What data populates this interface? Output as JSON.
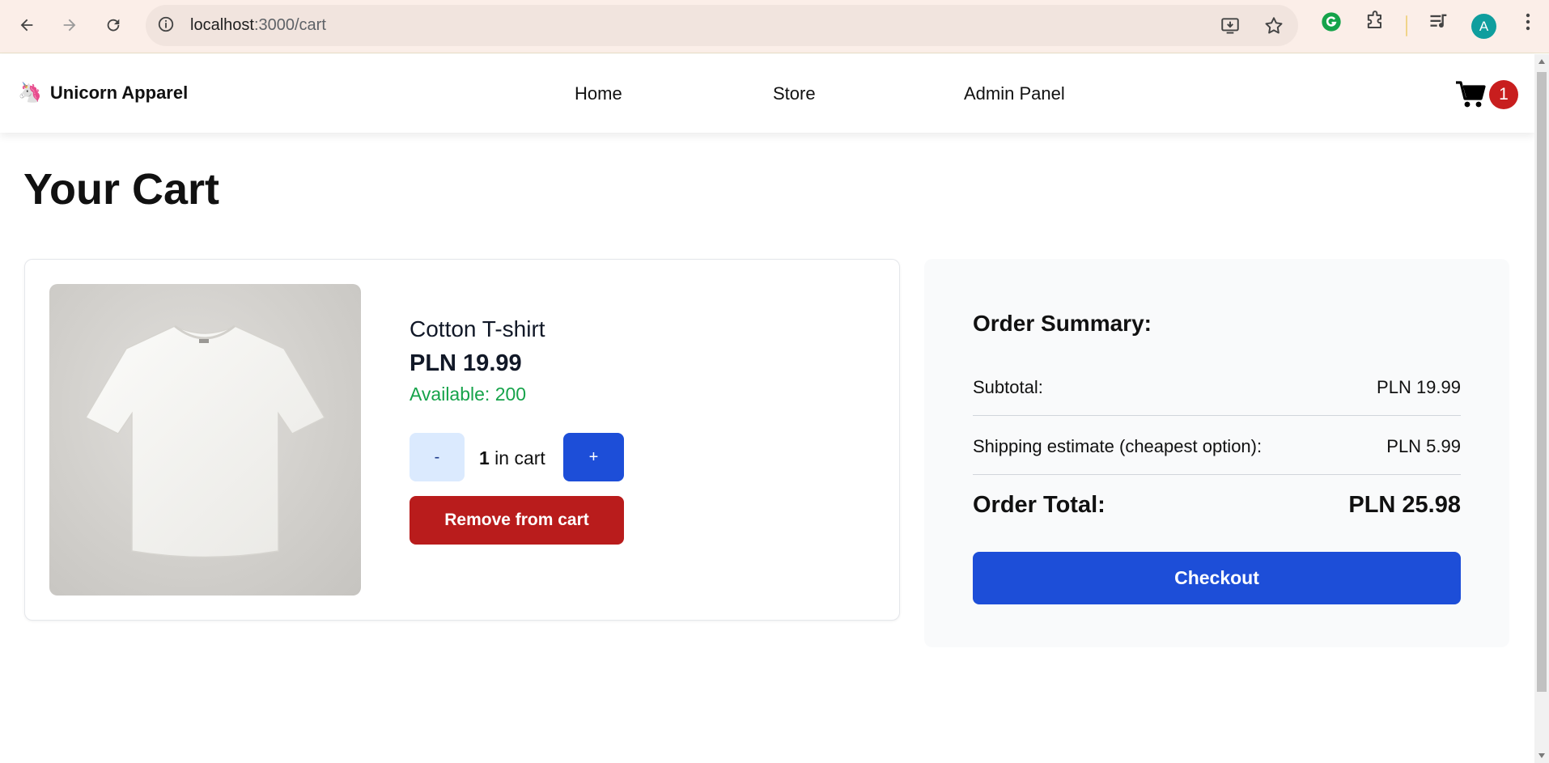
{
  "browser": {
    "url_host": "localhost",
    "url_path": ":3000/cart",
    "profile_initial": "A"
  },
  "header": {
    "brand_logo": "🦄",
    "brand_name": "Unicorn Apparel",
    "nav": [
      "Home",
      "Store",
      "Admin Panel"
    ],
    "cart_count": "1"
  },
  "page": {
    "title": "Your Cart"
  },
  "cart_item": {
    "name": "Cotton T-shirt",
    "price": "PLN 19.99",
    "available": "Available: 200",
    "qty_minus_label": "-",
    "qty_value": "1",
    "qty_suffix": " in cart",
    "qty_plus_label": "+",
    "remove_label": "Remove from cart"
  },
  "summary": {
    "title": "Order Summary:",
    "subtotal_label": "Subtotal:",
    "subtotal_value": "PLN 19.99",
    "shipping_label": "Shipping estimate (cheapest option):",
    "shipping_value": "PLN 5.99",
    "total_label": "Order Total:",
    "total_value": "PLN 25.98",
    "checkout_label": "Checkout"
  },
  "colors": {
    "primary": "#1d4ed8",
    "danger": "#b91c1c",
    "success": "#16a34a",
    "badge": "#c81e1e"
  }
}
